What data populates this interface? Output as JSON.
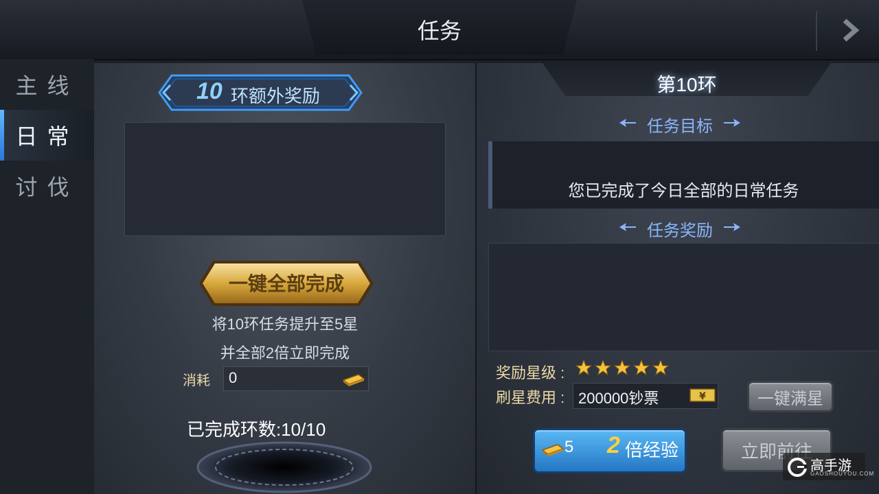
{
  "header": {
    "title": "任务"
  },
  "sidebar": {
    "items": [
      {
        "label": "主线",
        "active": false
      },
      {
        "label": "日常",
        "active": true
      },
      {
        "label": "讨伐",
        "active": false
      }
    ]
  },
  "left": {
    "banner": {
      "number": "10",
      "text": "环额外奖励"
    },
    "complete_all_button": "一键全部完成",
    "desc_line1": "将10环任务提升至5星",
    "desc_line2": "并全部2倍立即完成",
    "cost_label": "消耗",
    "cost_value": "0",
    "completed_label": "已完成环数:10/10"
  },
  "right": {
    "round_title": "第10环",
    "goal_heading": "任务目标",
    "goal_text": "您已完成了今日全部的日常任务",
    "reward_heading": "任务奖励",
    "star_label": "奖励星级 :",
    "star_count": 5,
    "fee_label": "刷星费用 :",
    "fee_value": "200000钞票",
    "fill_stars_button": "一键满星",
    "double_exp": {
      "cost": "5",
      "multiplier": "2",
      "label": "倍经验"
    },
    "go_button": "立即前往"
  },
  "watermark": {
    "text": "高手游",
    "sub": "GAOSHOUYOU.COM"
  },
  "colors": {
    "accent_blue": "#2577c4",
    "gold": "#d8a83c",
    "heading_blue": "#8ab6ff"
  }
}
